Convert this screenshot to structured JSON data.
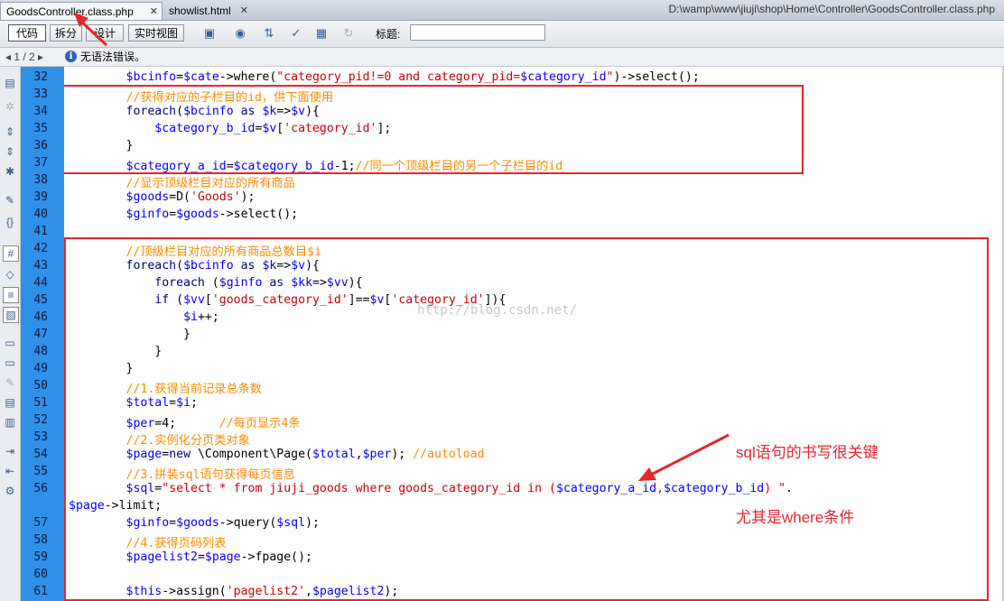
{
  "tabs": [
    {
      "label": "GoodsController.class.php",
      "active": true
    },
    {
      "label": "showlist.html",
      "active": false
    }
  ],
  "tab_close_glyph": "✕",
  "file_path": "D:\\wamp\\www\\jiuji\\shop\\Home\\Controller\\GoodsController.class.php",
  "toolbar": {
    "view_buttons": [
      "代码",
      "拆分",
      "设计",
      "实时视图"
    ],
    "title_label": "标题:",
    "title_value": ""
  },
  "status": {
    "nav": "◂  1 / 2  ▸",
    "message": "无语法错误。"
  },
  "line_numbers": [
    "32",
    "33",
    "34",
    "35",
    "36",
    "37",
    "38",
    "39",
    "40",
    "41",
    "42",
    "43",
    "44",
    "45",
    "46",
    "47",
    "48",
    "49",
    "50",
    "51",
    "52",
    "53",
    "54",
    "55",
    "56",
    "",
    "57",
    "58",
    "59",
    "60",
    "61"
  ],
  "code_lines": [
    "        $bcinfo=$cate->where(\"category_pid!=0 and category_pid=$category_id\")->select();",
    "        //获得对应的子栏目的id，供下面使用",
    "        foreach($bcinfo as $k=>$v){",
    "            $category_b_id=$v['category_id'];",
    "        }",
    "        $category_a_id=$category_b_id-1;//同一个顶级栏目的另一个子栏目的id",
    "        //显示顶级栏目对应的所有商品",
    "        $goods=D('Goods');",
    "        $ginfo=$goods->select();",
    "        ",
    "        //顶级栏目对应的所有商品总数目$i",
    "        foreach($bcinfo as $k=>$v){",
    "            foreach ($ginfo as $kk=>$vv){",
    "            if ($vv['goods_category_id']==$v['category_id']){",
    "                $i++;",
    "                }",
    "            }",
    "        }",
    "        //1.获得当前记录总条数",
    "        $total=$i;",
    "        $per=4;      //每页显示4条",
    "        //2.实例化分页类对象",
    "        $page=new \\Component\\Page($total,$per); //autoload",
    "        //3.拼装sql语句获得每页信息",
    "        $sql=\"select * from jiuji_goods where goods_category_id in ($category_a_id,$category_b_id) \".",
    "$page->limit;",
    "        $ginfo=$goods->query($sql);",
    "        //4.获得页码列表",
    "        $pagelist2=$page->fpage();",
    "        ",
    "        $this->assign('pagelist2',$pagelist2);"
  ],
  "annotation": {
    "line1": "sql语句的书写很关键",
    "line2": "尤其是where条件"
  },
  "watermark": "http://blog.csdn.net/",
  "colors": {
    "highlight_box": "#e8262a",
    "gutter": "#2f90e8",
    "variable": "#0000ff",
    "string": "#cc0000",
    "comment": "#ff8a00"
  }
}
